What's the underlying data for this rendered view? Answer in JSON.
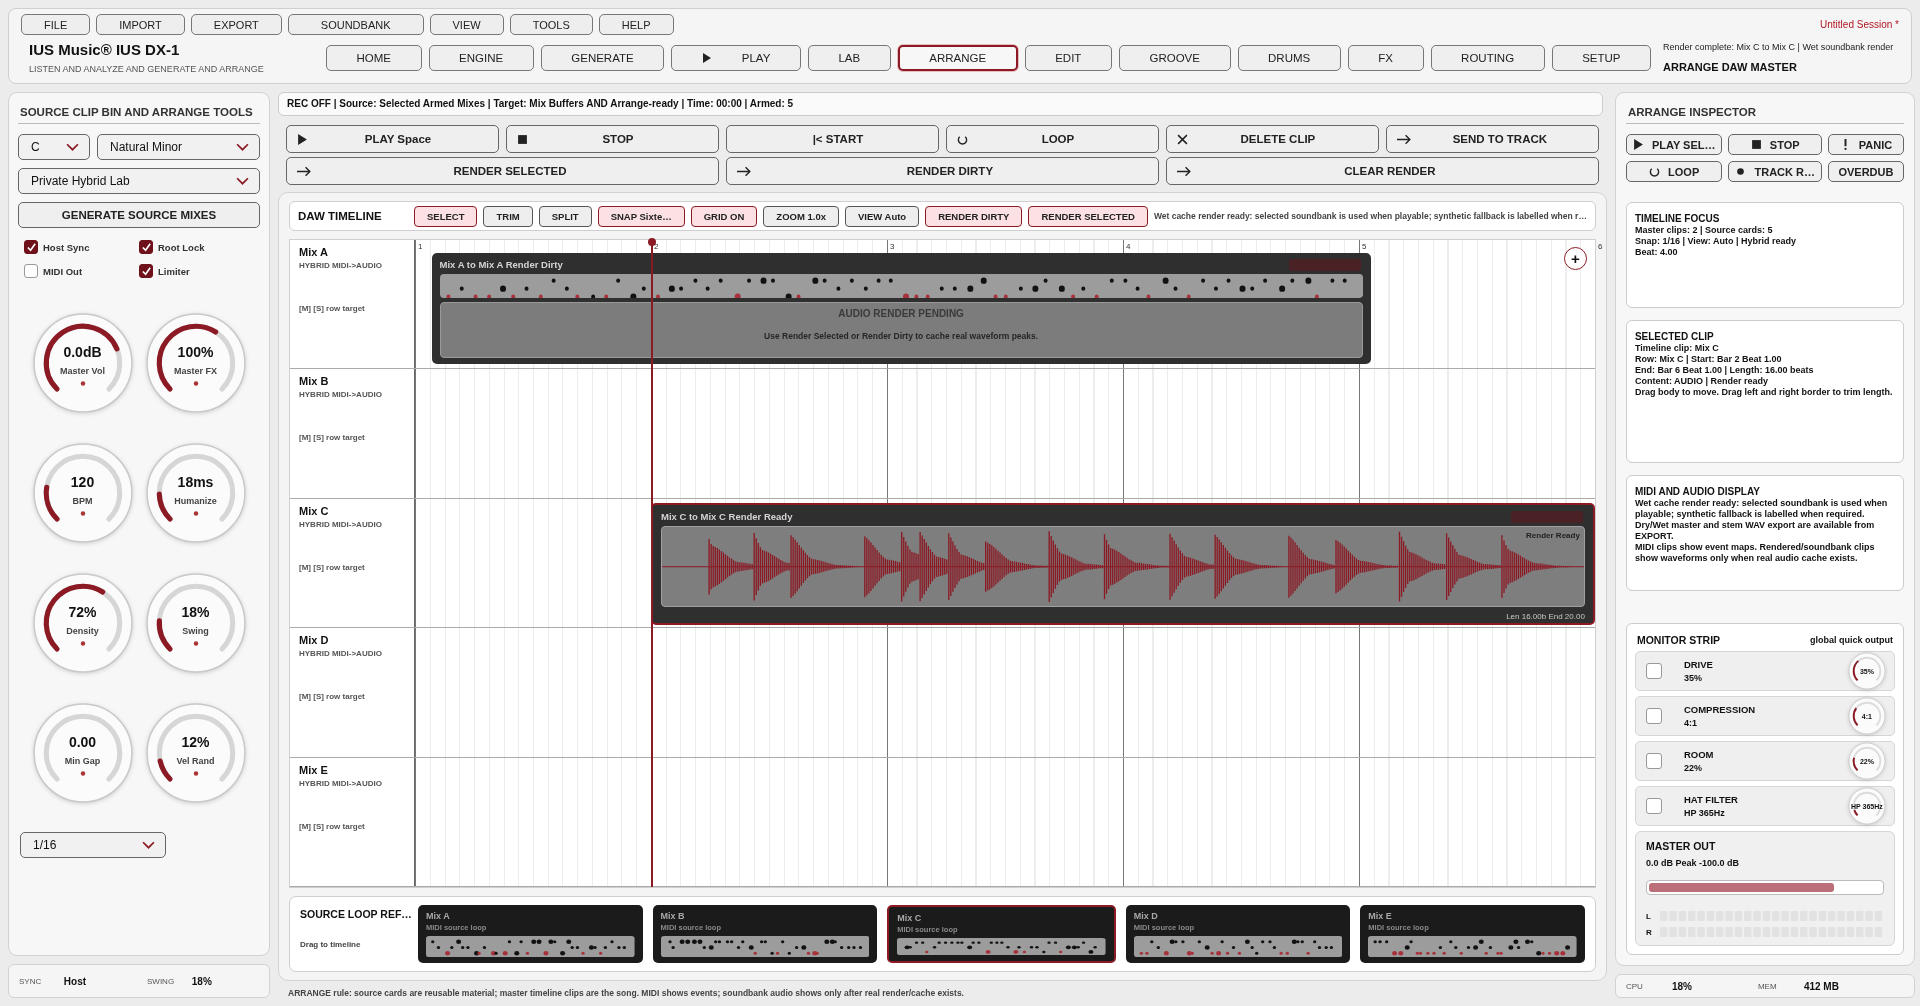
{
  "header": {
    "menu": [
      "FILE",
      "IMPORT",
      "EXPORT",
      "SOUNDBANK",
      "VIEW",
      "TOOLS",
      "HELP"
    ],
    "session": "Untitled Session  *",
    "app_title": "IUS Music® IUS DX-1",
    "subtitle": "LISTEN AND ANALYZE AND GENERATE AND ARRANGE",
    "tabs": [
      {
        "label": "HOME",
        "selected": false,
        "kind": "plain"
      },
      {
        "label": "ENGINE",
        "selected": false,
        "kind": "plain"
      },
      {
        "label": "GENERATE",
        "selected": false,
        "kind": "plain"
      },
      {
        "label": "PLAY",
        "selected": false,
        "kind": "play"
      },
      {
        "label": "LAB",
        "selected": false,
        "kind": "plain"
      },
      {
        "label": "ARRANGE",
        "selected": true,
        "kind": "plain"
      },
      {
        "label": "EDIT",
        "selected": false,
        "kind": "plain"
      },
      {
        "label": "GROOVE",
        "selected": false,
        "kind": "plain"
      },
      {
        "label": "DRUMS",
        "selected": false,
        "kind": "plain"
      },
      {
        "label": "FX",
        "selected": false,
        "kind": "plain"
      },
      {
        "label": "ROUTING",
        "selected": false,
        "kind": "plain"
      },
      {
        "label": "SETUP",
        "selected": false,
        "kind": "plain"
      }
    ],
    "render_status": "Render complete: Mix C to Mix C | Wet soundbank render",
    "mode": "ARRANGE DAW MASTER"
  },
  "left_panel": {
    "title": "SOURCE CLIP BIN AND ARRANGE TOOLS",
    "key": "C",
    "scale": "Natural Minor",
    "soundbank": "Private Hybrid Lab",
    "generate_button": "GENERATE SOURCE MIXES",
    "options": [
      {
        "label": "Host Sync",
        "checked": true
      },
      {
        "label": "Root Lock",
        "checked": true
      },
      {
        "label": "MIDI Out",
        "checked": false
      },
      {
        "label": "Limiter",
        "checked": true
      }
    ],
    "knobs": [
      {
        "value": "0.0dB",
        "label": "Master Vol"
      },
      {
        "value": "100%",
        "label": "Master FX"
      },
      {
        "value": "120",
        "label": "BPM"
      },
      {
        "value": "18ms",
        "label": "Humanize"
      },
      {
        "value": "72%",
        "label": "Density"
      },
      {
        "value": "18%",
        "label": "Swing"
      },
      {
        "value": "0.00",
        "label": "Min Gap"
      },
      {
        "value": "12%",
        "label": "Vel Rand"
      }
    ],
    "grid": "1/16"
  },
  "left_status": [
    {
      "label": "SYNC",
      "value": "Host"
    },
    {
      "label": "SWING",
      "value": "18%"
    }
  ],
  "center": {
    "status": "REC OFF | Source: Selected Armed Mixes | Target: Mix Buffers AND Arrange-ready | Time: 00:00 | Armed: 5",
    "transport": [
      {
        "label": "PLAY  Space",
        "kind": "play"
      },
      {
        "label": "STOP",
        "kind": "stop"
      },
      {
        "label": "|< START",
        "kind": "none"
      },
      {
        "label": "LOOP",
        "kind": "loop"
      },
      {
        "label": "DELETE CLIP",
        "kind": "close"
      },
      {
        "label": "SEND TO TRACK",
        "kind": "arrow"
      }
    ],
    "render": [
      {
        "label": "RENDER SELECTED",
        "kind": "arrow"
      },
      {
        "label": "RENDER DIRTY",
        "kind": "arrow"
      },
      {
        "label": "CLEAR RENDER",
        "kind": "arrow"
      }
    ],
    "timeline": {
      "title": "DAW TIMELINE",
      "tools": [
        {
          "label": "SELECT",
          "on": true
        },
        {
          "label": "TRIM",
          "on": false
        },
        {
          "label": "SPLIT",
          "on": false
        },
        {
          "label": "SNAP Sixte…",
          "on": true
        },
        {
          "label": "GRID ON",
          "on": true
        },
        {
          "label": "ZOOM 1.0x",
          "on": false
        },
        {
          "label": "VIEW Auto",
          "on": false
        },
        {
          "label": "RENDER DIRTY",
          "on": true
        },
        {
          "label": "RENDER SELECTED",
          "on": true
        }
      ],
      "message": "Wet cache render ready: selected soundbank is used when playable; synthetic fallback is labelled when r…",
      "ruler": [
        "1",
        "2",
        "3",
        "4",
        "5",
        "6"
      ],
      "add_button": "+",
      "tracks": [
        {
          "name": "Mix A",
          "type": "HYBRID MIDI->AUDIO",
          "target": "[M] [S] row target",
          "clip": {
            "kind": "midi",
            "title": "Mix A to Mix A  Render Dirty",
            "selected": false,
            "pending_title": "AUDIO RENDER PENDING",
            "pending_hint": "Use Render Selected or Render Dirty to cache real waveform peaks."
          }
        },
        {
          "name": "Mix B",
          "type": "HYBRID MIDI->AUDIO",
          "target": "[M] [S] row target"
        },
        {
          "name": "Mix C",
          "type": "HYBRID MIDI->AUDIO",
          "target": "[M] [S] row target",
          "clip": {
            "kind": "audio",
            "title": "Mix C to Mix C  Render Ready",
            "selected": true,
            "badge": "Render Ready",
            "info": "Len 16.00b  End 20.00"
          }
        },
        {
          "name": "Mix D",
          "type": "HYBRID MIDI->AUDIO",
          "target": "[M] [S] row target"
        },
        {
          "name": "Mix E",
          "type": "HYBRID MIDI->AUDIO",
          "target": "[M] [S] row target"
        }
      ]
    },
    "source_loops": {
      "title": "SOURCE LOOP REF…",
      "hint": "Drag to timeline",
      "cards": [
        {
          "name": "Mix A",
          "type": "MIDI source loop",
          "selected": false
        },
        {
          "name": "Mix B",
          "type": "MIDI source loop",
          "selected": false
        },
        {
          "name": "Mix C",
          "type": "MIDI source loop",
          "selected": true
        },
        {
          "name": "Mix D",
          "type": "MIDI source loop",
          "selected": false
        },
        {
          "name": "Mix E",
          "type": "MIDI source loop",
          "selected": false
        }
      ]
    },
    "footer": "ARRANGE rule: source cards are reusable material; master timeline clips are the song. MIDI shows events; soundbank audio shows only after real render/cache exists."
  },
  "inspector": {
    "title": "ARRANGE INSPECTOR",
    "buttons": [
      {
        "label": "PLAY SEL…",
        "kind": "play"
      },
      {
        "label": "STOP",
        "kind": "stop"
      },
      {
        "label": "PANIC",
        "kind": "alert"
      },
      {
        "label": "LOOP",
        "kind": "loop"
      },
      {
        "label": "TRACK R…",
        "kind": "record"
      },
      {
        "label": "OVERDUB",
        "kind": "none"
      }
    ],
    "cards": [
      {
        "title": "TIMELINE FOCUS",
        "lines": [
          "Master clips: 2 | Source cards: 5",
          "Snap: 1/16 | View: Auto | Hybrid ready",
          "Beat: 4.00"
        ]
      },
      {
        "title": "SELECTED CLIP",
        "lines": [
          "Timeline clip: Mix C",
          "Row: Mix C | Start: Bar 2 Beat 1.00",
          "End: Bar 6 Beat 1.00 | Length: 16.00 beats",
          "Content: AUDIO | Render ready",
          "Drag body to move. Drag left and right border to trim length."
        ]
      },
      {
        "title": "MIDI AND AUDIO DISPLAY",
        "lines": [
          "Wet cache render ready: selected soundbank is used when playable; synthetic fallback is labelled when required. Dry/Wet master and stem WAV export are available from EXPORT.",
          "MIDI clips show event maps. Rendered/soundbank clips show waveforms only when real audio cache exists."
        ]
      }
    ],
    "monitor": {
      "title": "MONITOR STRIP",
      "note": "global quick output",
      "items": [
        {
          "name": "DRIVE",
          "value": "35%",
          "knob": "35%",
          "checked": false
        },
        {
          "name": "COMPRESSION",
          "value": "4:1",
          "knob": "4:1",
          "checked": false
        },
        {
          "name": "ROOM",
          "value": "22%",
          "knob": "22%",
          "checked": false
        },
        {
          "name": "HAT FILTER",
          "value": "HP 365Hz",
          "knob": "HP 365Hz",
          "checked": false
        }
      ],
      "master": {
        "title": "MASTER OUT",
        "reading": "0.0 dB   Peak -100.0 dB",
        "level": 0.8,
        "channels": [
          "L",
          "R"
        ]
      }
    }
  },
  "right_status": [
    {
      "label": "CPU",
      "value": "18%"
    },
    {
      "label": "MEM",
      "value": "412 MB"
    }
  ]
}
